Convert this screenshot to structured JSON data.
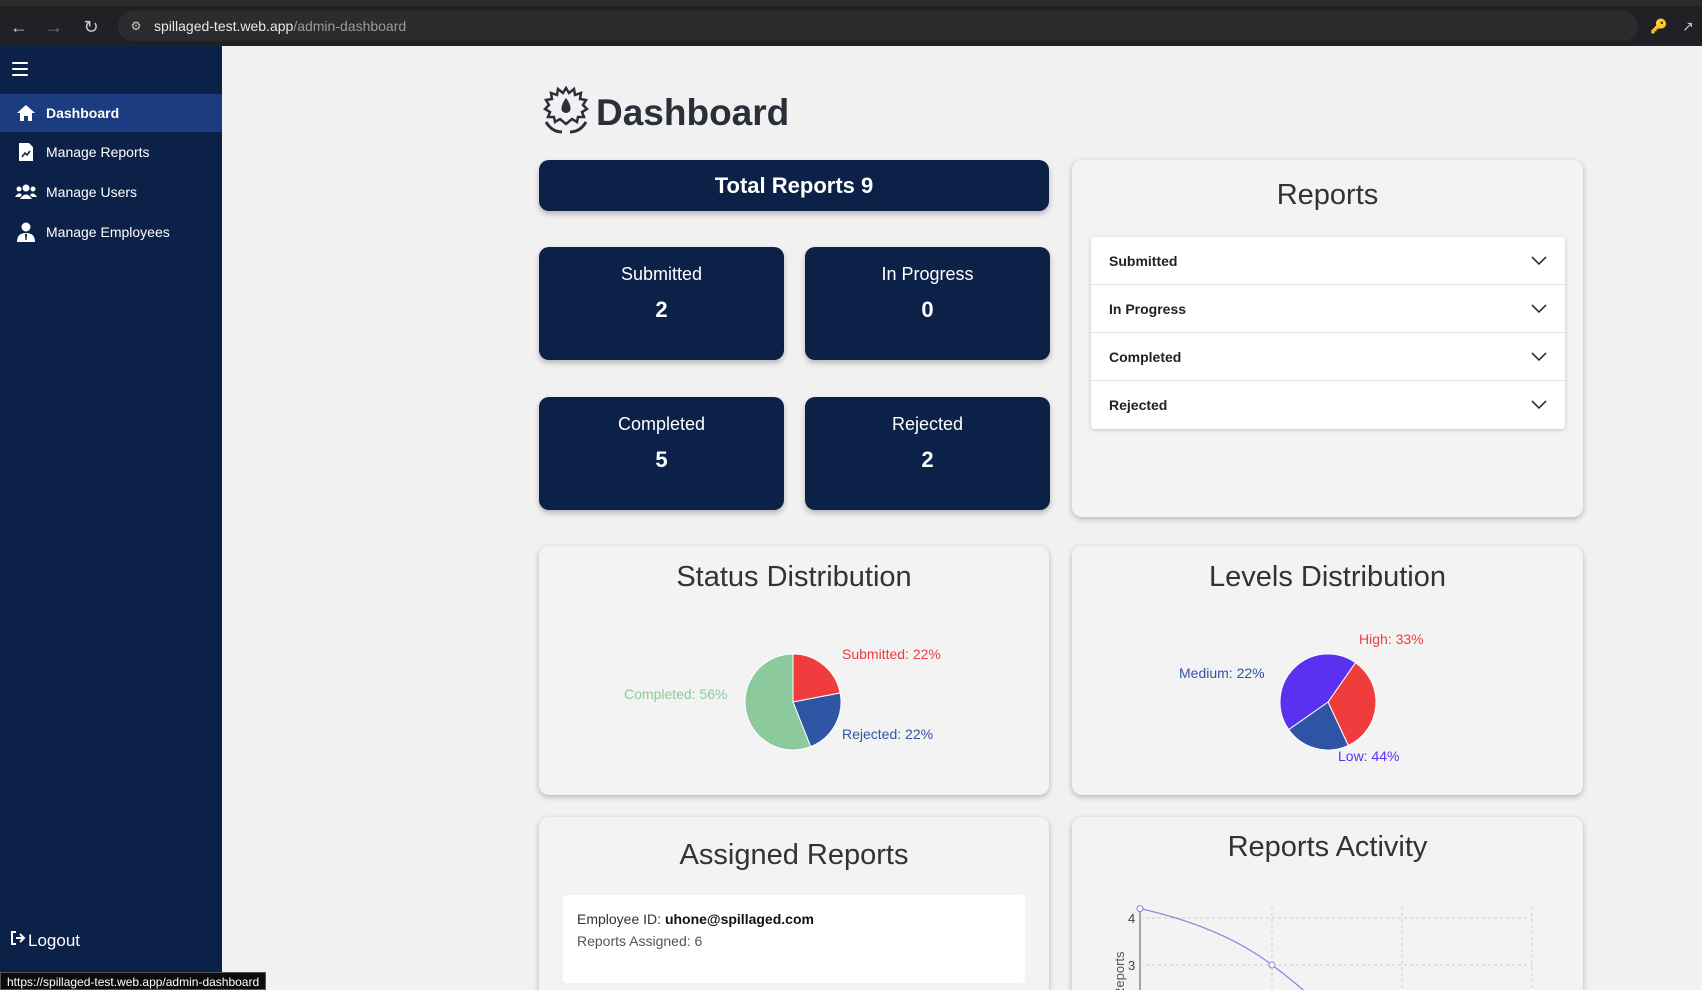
{
  "browser": {
    "url_host": "spillaged-test.web.app",
    "url_path": "/admin-dashboard",
    "status_url": "https://spillaged-test.web.app/admin-dashboard"
  },
  "sidebar": {
    "items": [
      {
        "label": "Dashboard",
        "icon": "home-icon",
        "active": true
      },
      {
        "label": "Manage Reports",
        "icon": "report-icon",
        "active": false
      },
      {
        "label": "Manage Users",
        "icon": "users-icon",
        "active": false
      },
      {
        "label": "Manage Employees",
        "icon": "employee-icon",
        "active": false
      }
    ],
    "logout_label": "Logout"
  },
  "main": {
    "title": "Dashboard",
    "total_reports": "Total Reports 9",
    "stats": [
      {
        "label": "Submitted",
        "value": "2"
      },
      {
        "label": "In Progress",
        "value": "0"
      },
      {
        "label": "Completed",
        "value": "5"
      },
      {
        "label": "Rejected",
        "value": "2"
      }
    ],
    "reports_panel": {
      "title": "Reports",
      "items": [
        "Submitted",
        "In Progress",
        "Completed",
        "Rejected"
      ]
    },
    "status_distribution": {
      "title": "Status Distribution",
      "labels": {
        "submitted": "Submitted: 22%",
        "rejected": "Rejected: 22%",
        "completed": "Completed: 56%"
      }
    },
    "levels_distribution": {
      "title": "Levels Distribution",
      "labels": {
        "high": "High: 33%",
        "medium": "Medium: 22%",
        "low": "Low: 44%"
      }
    },
    "assigned_reports": {
      "title": "Assigned Reports",
      "employee_prefix": "Employee ID:",
      "employee_id": "uhone@spillaged.com",
      "assigned_line": "Reports Assigned: 6"
    },
    "reports_activity": {
      "title": "Reports Activity",
      "ylabel": "Reports",
      "tick_4": "4",
      "tick_3": "3"
    }
  },
  "colors": {
    "navy": "#0c2148",
    "active": "#1b3c80",
    "submitted": "#f03c3c",
    "rejected": "#2e55a4",
    "completed": "#8cca9e",
    "high": "#f03c3c",
    "medium": "#2e55a4",
    "low": "#5b30f0"
  },
  "chart_data": [
    {
      "type": "pie",
      "title": "Status Distribution",
      "categories": [
        "Submitted",
        "Rejected",
        "Completed"
      ],
      "values": [
        22,
        22,
        56
      ]
    },
    {
      "type": "pie",
      "title": "Levels Distribution",
      "categories": [
        "High",
        "Medium",
        "Low"
      ],
      "values": [
        33,
        22,
        44
      ]
    },
    {
      "type": "line",
      "title": "Reports Activity",
      "ylabel": "Reports",
      "series": [
        {
          "values": [
            4.2,
            3
          ]
        }
      ],
      "yticks": [
        3,
        4
      ]
    }
  ]
}
